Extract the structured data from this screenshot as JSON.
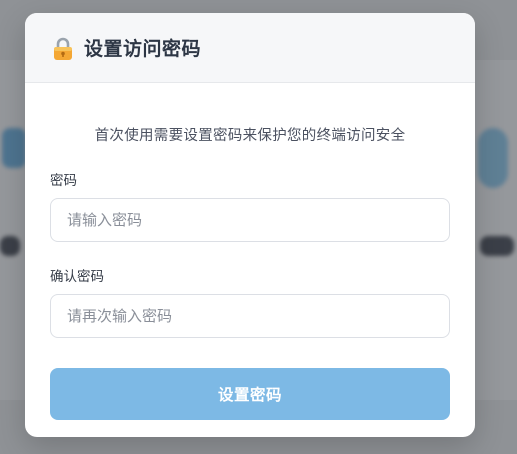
{
  "dialog": {
    "icon": "lock-icon",
    "title": "设置访问密码",
    "description": "首次使用需要设置密码来保护您的终端访问安全"
  },
  "form": {
    "password": {
      "label": "密码",
      "placeholder": "请输入密码",
      "value": ""
    },
    "confirm_password": {
      "label": "确认密码",
      "placeholder": "请再次输入密码",
      "value": ""
    },
    "submit_label": "设置密码"
  },
  "colors": {
    "accent_button": "#7db9e5",
    "header_bg": "#f6f7f9",
    "title_text": "#2d3645"
  }
}
